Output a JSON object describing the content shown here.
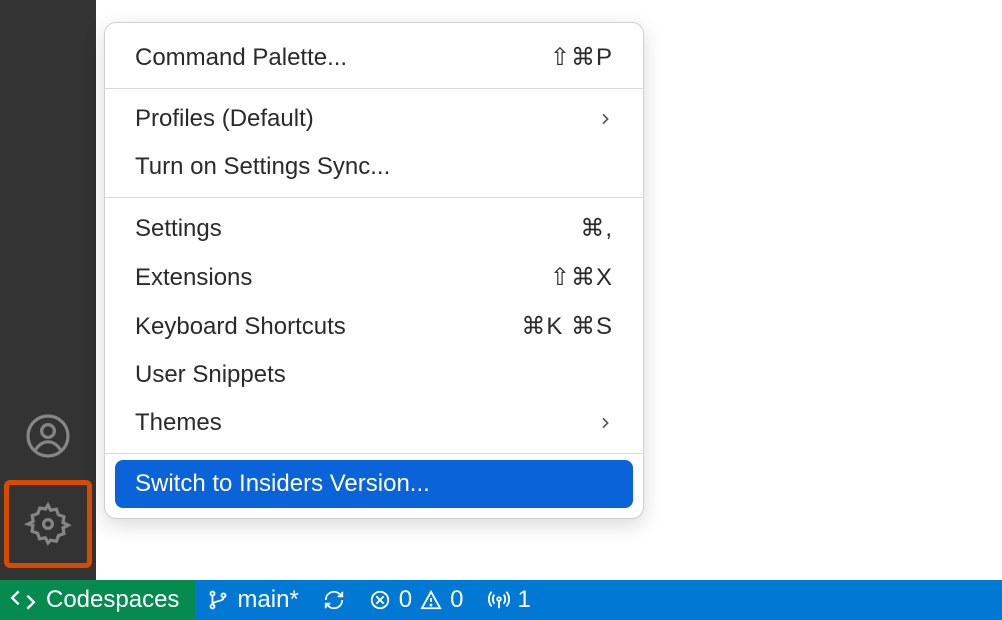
{
  "menu": {
    "items": [
      {
        "label": "Command Palette...",
        "shortcut": "⇧⌘P"
      },
      {
        "label": "Profiles (Default)",
        "submenu": true
      },
      {
        "label": "Turn on Settings Sync..."
      },
      {
        "label": "Settings",
        "shortcut": "⌘,"
      },
      {
        "label": "Extensions",
        "shortcut": "⇧⌘X"
      },
      {
        "label": "Keyboard Shortcuts",
        "shortcut": "⌘K ⌘S"
      },
      {
        "label": "User Snippets"
      },
      {
        "label": "Themes",
        "submenu": true
      },
      {
        "label": "Switch to Insiders Version...",
        "selected": true
      }
    ]
  },
  "status": {
    "codespaces": "Codespaces",
    "branch": "main*",
    "errors": "0",
    "warnings": "0",
    "ports": "1"
  }
}
